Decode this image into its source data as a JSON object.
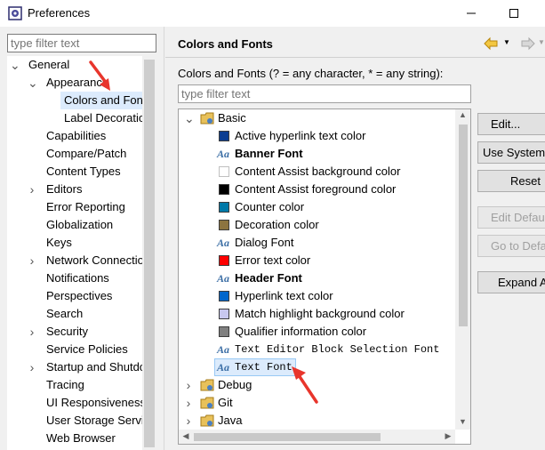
{
  "window": {
    "title": "Preferences"
  },
  "left": {
    "filter_placeholder": "type filter text",
    "tree": [
      {
        "label": "General",
        "level": 0,
        "twisty": "open"
      },
      {
        "label": "Appearance",
        "level": 1,
        "twisty": "open"
      },
      {
        "label": "Colors and Fonts",
        "level": 2,
        "twisty": "none",
        "selected": true
      },
      {
        "label": "Label Decorations",
        "level": 2,
        "twisty": "none"
      },
      {
        "label": "Capabilities",
        "level": 1,
        "twisty": "none"
      },
      {
        "label": "Compare/Patch",
        "level": 1,
        "twisty": "none"
      },
      {
        "label": "Content Types",
        "level": 1,
        "twisty": "none"
      },
      {
        "label": "Editors",
        "level": 1,
        "twisty": "closed"
      },
      {
        "label": "Error Reporting",
        "level": 1,
        "twisty": "none"
      },
      {
        "label": "Globalization",
        "level": 1,
        "twisty": "none"
      },
      {
        "label": "Keys",
        "level": 1,
        "twisty": "none"
      },
      {
        "label": "Network Connections",
        "level": 1,
        "twisty": "closed"
      },
      {
        "label": "Notifications",
        "level": 1,
        "twisty": "none"
      },
      {
        "label": "Perspectives",
        "level": 1,
        "twisty": "none"
      },
      {
        "label": "Search",
        "level": 1,
        "twisty": "none"
      },
      {
        "label": "Security",
        "level": 1,
        "twisty": "closed"
      },
      {
        "label": "Service Policies",
        "level": 1,
        "twisty": "none"
      },
      {
        "label": "Startup and Shutdown",
        "level": 1,
        "twisty": "closed"
      },
      {
        "label": "Tracing",
        "level": 1,
        "twisty": "none"
      },
      {
        "label": "UI Responsiveness",
        "level": 1,
        "twisty": "none"
      },
      {
        "label": "User Storage Service",
        "level": 1,
        "twisty": "none"
      },
      {
        "label": "Web Browser",
        "level": 1,
        "twisty": "none"
      }
    ]
  },
  "right": {
    "title": "Colors and Fonts",
    "description": "Colors and Fonts (? = any character, * = any string):",
    "filter_placeholder": "type filter text",
    "tree": [
      {
        "label": "Basic",
        "kind": "folder",
        "level": 0,
        "twisty": "open"
      },
      {
        "label": "Active hyperlink text color",
        "kind": "color",
        "color": "#0b3d91",
        "level": 1
      },
      {
        "label": "Banner Font",
        "kind": "font",
        "level": 1,
        "style": "bold"
      },
      {
        "label": "Content Assist background color",
        "kind": "color",
        "color": "#ffffff",
        "level": 1
      },
      {
        "label": "Content Assist foreground color",
        "kind": "color",
        "color": "#000000",
        "level": 1
      },
      {
        "label": "Counter color",
        "kind": "color",
        "color": "#0079a8",
        "level": 1
      },
      {
        "label": "Decoration color",
        "kind": "color",
        "color": "#8c7440",
        "level": 1
      },
      {
        "label": "Dialog Font",
        "kind": "font",
        "level": 1,
        "style": "normal"
      },
      {
        "label": "Error text color",
        "kind": "color",
        "color": "#ff0000",
        "level": 1
      },
      {
        "label": "Header Font",
        "kind": "font",
        "level": 1,
        "style": "bold"
      },
      {
        "label": "Hyperlink text color",
        "kind": "color",
        "color": "#0066cc",
        "level": 1
      },
      {
        "label": "Match highlight background color",
        "kind": "color",
        "color": "#c8c8f0",
        "level": 1
      },
      {
        "label": "Qualifier information color",
        "kind": "color",
        "color": "#808080",
        "level": 1
      },
      {
        "label": "Text Editor Block Selection Font",
        "kind": "font",
        "level": 1,
        "style": "mono"
      },
      {
        "label": "Text Font",
        "kind": "font",
        "level": 1,
        "style": "mono",
        "selected": true
      },
      {
        "label": "Debug",
        "kind": "folder",
        "level": 0,
        "twisty": "closed"
      },
      {
        "label": "Git",
        "kind": "folder",
        "level": 0,
        "twisty": "closed"
      },
      {
        "label": "Java",
        "kind": "folder",
        "level": 0,
        "twisty": "closed"
      }
    ]
  },
  "buttons": {
    "edit": "Edit...",
    "use_system_font": "Use System Font",
    "reset": "Reset",
    "edit_default": "Edit Default...",
    "go_to_default": "Go to Default",
    "expand_all": "Expand All"
  },
  "icons": {
    "app": "eclipse-preferences-icon",
    "minimize": "minimize-icon",
    "maximize": "maximize-icon",
    "back": "back-arrow-icon",
    "forward": "forward-arrow-icon"
  },
  "colors": {
    "selection_bg": "#dcebfc",
    "annotation_red": "#e8352c",
    "font_icon": "#3b6ea5"
  }
}
